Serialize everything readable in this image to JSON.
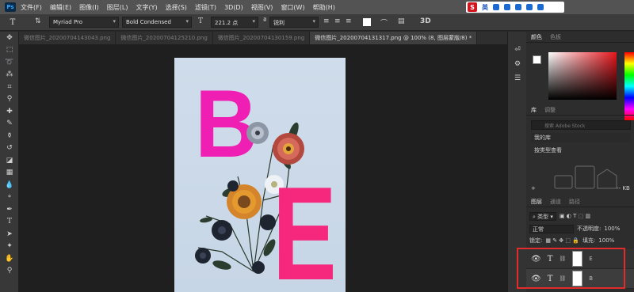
{
  "menubar": {
    "logo": "Ps",
    "items": [
      "文件(F)",
      "编辑(E)",
      "图像(I)",
      "图层(L)",
      "文字(Y)",
      "选择(S)",
      "滤镜(T)",
      "3D(D)",
      "视图(V)",
      "窗口(W)",
      "帮助(H)"
    ],
    "ime": {
      "logo": "S",
      "label": "英"
    }
  },
  "options": {
    "font_family": "Myriad Pro",
    "font_style": "Bold Condensed",
    "font_size": "221.2 点",
    "antialias": "锐利",
    "size_icon": "T"
  },
  "tabs": [
    {
      "label": "微信图片_20200704143043.png",
      "active": false
    },
    {
      "label": "微信图片_20200704125210.png",
      "active": false
    },
    {
      "label": "微信图片_20200704130159.png",
      "active": false
    },
    {
      "label": "微信图片_20200704131317.png @ 100% (8, 图层蒙版/8) *",
      "active": true
    }
  ],
  "canvas": {
    "letter1": "B",
    "letter2": "E"
  },
  "panels": {
    "color_tabs": [
      "颜色",
      "色板"
    ],
    "library_tabs": [
      "库",
      "调整"
    ],
    "library_search": "搜索 Adobe Stock",
    "library_select": "我的库",
    "library_group": "按类型查看",
    "library_size": "-- KB",
    "layers_tabs": [
      "图层",
      "通道",
      "路径"
    ],
    "filter_label": "类型",
    "blend_mode": "正常",
    "opacity_label": "不透明度:",
    "opacity_value": "100%",
    "lock_label": "锁定:",
    "fill_label": "填充:",
    "fill_value": "100%",
    "layers": [
      {
        "name": "E",
        "type": "T"
      },
      {
        "name": "B",
        "type": "T"
      }
    ]
  },
  "colors": {
    "pink_b": "#f01fb4",
    "pink_e": "#f5287e",
    "highlight": "#e22b2b"
  }
}
